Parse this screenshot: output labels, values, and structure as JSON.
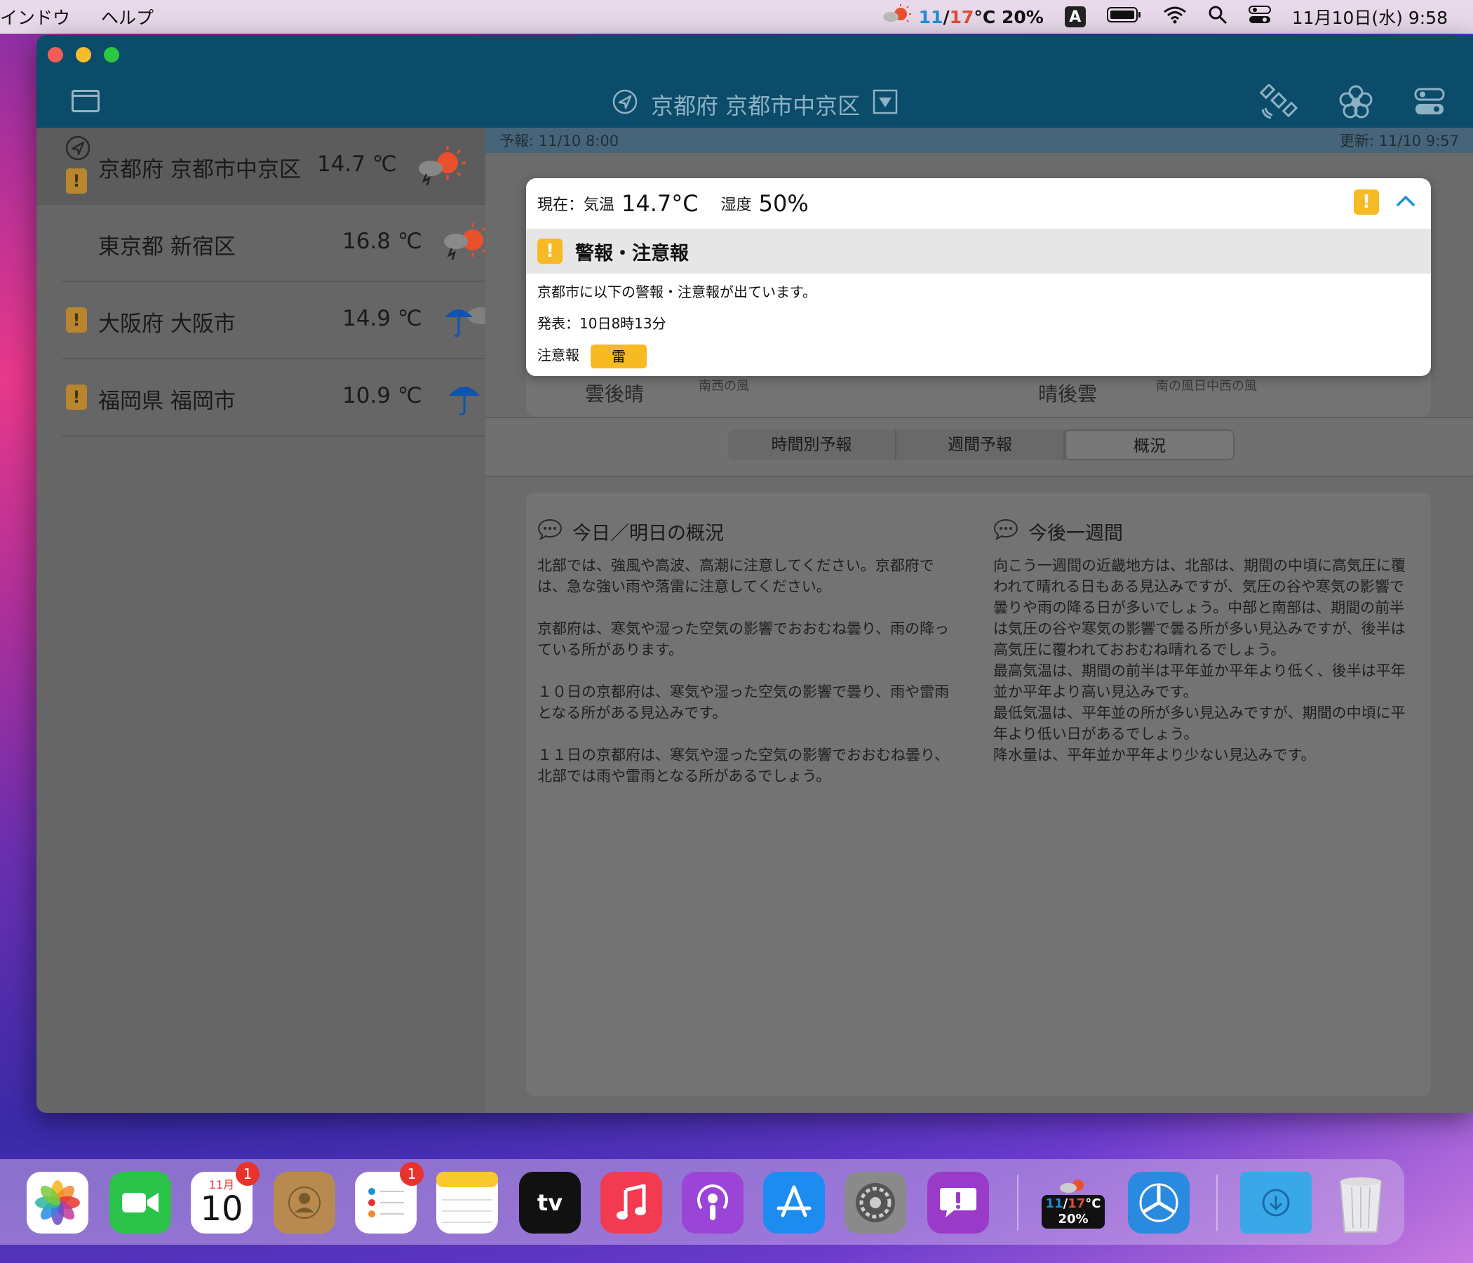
{
  "menubar": {
    "menus": [
      "インドウ",
      "ヘルプ"
    ],
    "weather_low": "11",
    "weather_high": "17",
    "weather_unit_humidity": "°C 20%",
    "input_mode": "A",
    "clock": "11月10日(水)  9:58"
  },
  "window": {
    "title": "京都府 京都市中京区",
    "forecast_time": "予報: 11/10 8:00",
    "updated_time": "更新: 11/10 9:57"
  },
  "locations": [
    {
      "name": "京都府 京都市中京区",
      "temp": "14.7 ℃",
      "icon": "cloudy-sun-icon",
      "warning": true,
      "current": true
    },
    {
      "name": "東京都 新宿区",
      "temp": "16.8 ℃",
      "icon": "cloudy-sun-icon",
      "warning": false,
      "current": false
    },
    {
      "name": "大阪府 大阪市",
      "temp": "14.9 ℃",
      "icon": "umbrella-cloud-icon",
      "warning": true,
      "current": false
    },
    {
      "name": "福岡県 福岡市",
      "temp": "10.9 ℃",
      "icon": "umbrella-icon",
      "warning": true,
      "current": false
    }
  ],
  "popup": {
    "current_label": "現在：気温",
    "current_temp": "14.7°C",
    "humidity_label": "湿度",
    "humidity": "50%",
    "section_title": "警報・注意報",
    "message": "京都市に以下の警報・注意報が出ています。",
    "issued": "発表：10日8時13分",
    "advisory_label": "注意報",
    "advisory_item": "雷"
  },
  "card_behind": {
    "left_weather": "雲後晴",
    "right_weather": "晴後雲",
    "left_wind": "南西の風",
    "right_wind": "南の風日中西の風"
  },
  "tabs": [
    "時間別予報",
    "週間予報",
    "概況"
  ],
  "summary": {
    "today_title": "今日／明日の概況",
    "today_text": "北部では、強風や高波、高潮に注意してください。京都府では、急な強い雨や落雷に注意してください。\n\n京都府は、寒気や湿った空気の影響でおおむね曇り、雨の降っている所があります。\n\n１０日の京都府は、寒気や湿った空気の影響で曇り、雨や雷雨となる所がある見込みです。\n\n１１日の京都府は、寒気や湿った空気の影響でおおむね曇り、北部では雨や雷雨となる所があるでしょう。",
    "week_title": "今後一週間",
    "week_text": "向こう一週間の近畿地方は、北部は、期間の中頃に高気圧に覆われて晴れる日もある見込みですが、気圧の谷や寒気の影響で曇りや雨の降る日が多いでしょう。中部と南部は、期間の前半は気圧の谷や寒気の影響で曇る所が多い見込みですが、後半は高気圧に覆われておおむね晴れるでしょう。\n最高気温は、期間の前半は平年並か平年より低く、後半は平年並か平年より高い見込みです。\n最低気温は、平年並の所が多い見込みですが、期間の中頃に平年より低い日があるでしょう。\n降水量は、平年並か平年より少ない見込みです。"
  },
  "dock": {
    "calendar_month": "11月",
    "calendar_day": "10",
    "calendar_badge": "1",
    "reminders_badge": "1",
    "weather_widget_low": "11",
    "weather_widget_high": "17",
    "weather_widget_unit": "°C",
    "weather_widget_humidity": "20%",
    "apps": [
      "photos-icon",
      "facetime-icon",
      "calendar-icon",
      "contacts-icon",
      "reminders-icon",
      "notes-icon",
      "apple-tv-icon",
      "music-icon",
      "podcasts-icon",
      "app-store-icon",
      "system-preferences-icon",
      "feedback-icon",
      "weather-app-icon",
      "network-radar-icon",
      "downloads-folder-icon",
      "trash-icon"
    ]
  }
}
